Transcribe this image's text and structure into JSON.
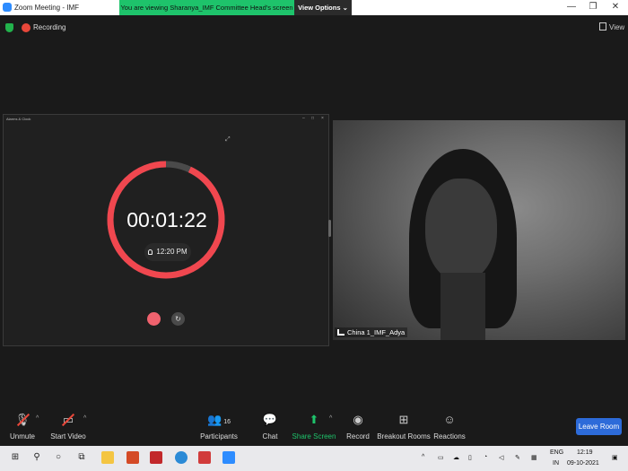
{
  "window": {
    "title": "Zoom Meeting - IMF"
  },
  "banner": {
    "text": "You are viewing Sharanya_IMF Committee Head's screen",
    "view_options": "View Options ⌄"
  },
  "top": {
    "recording": "Recording",
    "view": "View"
  },
  "shared_window": {
    "title": "Alarms & Clock",
    "timer": "00:01:22",
    "alarm_time": "12:20 PM",
    "progress": 0.93
  },
  "video": {
    "participant": "China 1_IMF_Adya"
  },
  "toolbar": {
    "unmute": "Unmute",
    "start_video": "Start Video",
    "participants": "Participants",
    "participants_count": "16",
    "chat": "Chat",
    "share_screen": "Share Screen",
    "record": "Record",
    "breakout_rooms": "Breakout Rooms",
    "reactions": "Reactions",
    "leave_room": "Leave Room"
  },
  "taskbar": {
    "lang": "ENG",
    "region": "IN",
    "time": "12:19",
    "date": "09-10-2021"
  },
  "colors": {
    "accent_green": "#1ec36b",
    "timer_ring": "#f0474f",
    "leave_blue": "#2d6bd9"
  }
}
